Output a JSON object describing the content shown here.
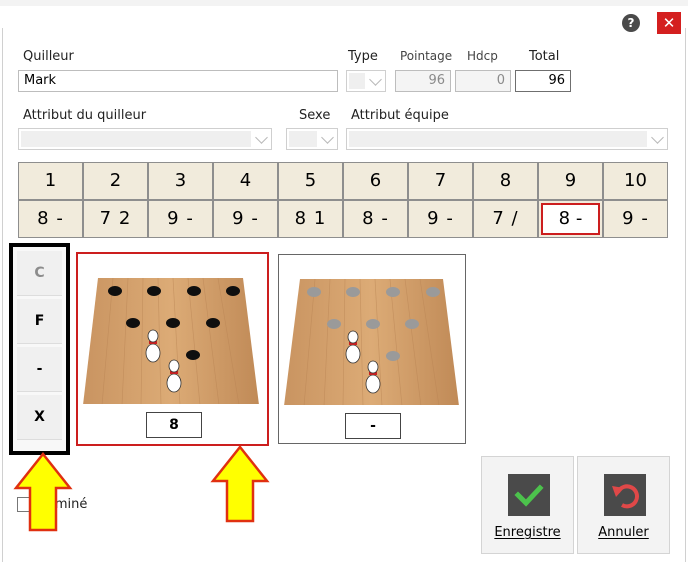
{
  "titlebar": {
    "help_icon": "?",
    "close_icon": "✕"
  },
  "bowler": {
    "label": "Quilleur",
    "value": "Mark",
    "type_label": "Type",
    "pointage_label": "Pointage",
    "pointage_value": "96",
    "hdcp_label": "Hdcp",
    "hdcp_value": "0",
    "total_label": "Total",
    "total_value": "96"
  },
  "attributes": {
    "bowler_attr_label": "Attribut du quilleur",
    "sexe_label": "Sexe",
    "team_attr_label": "Attribut équipe"
  },
  "frames": [
    {
      "num": "1",
      "score": "8 -"
    },
    {
      "num": "2",
      "score": "7 2"
    },
    {
      "num": "3",
      "score": "9 -"
    },
    {
      "num": "4",
      "score": "9 -"
    },
    {
      "num": "5",
      "score": "8 1"
    },
    {
      "num": "6",
      "score": "8 -"
    },
    {
      "num": "7",
      "score": "9 -"
    },
    {
      "num": "8",
      "score": "7 /"
    },
    {
      "num": "9",
      "score": "8 -"
    },
    {
      "num": "10",
      "score": "9 -"
    }
  ],
  "selected_frame": 9,
  "quick_buttons": [
    "C",
    "F",
    "-",
    "X"
  ],
  "rolls": [
    {
      "value": "8"
    },
    {
      "value": "-"
    }
  ],
  "finished_label": "Terminé",
  "actions": {
    "save_label": "Enregistre",
    "cancel_label": "Annuler"
  },
  "colors": {
    "close_red": "#d41f1f",
    "selection_red": "#cc1e1e",
    "frame_bg": "#f1ebdc",
    "arrow_yellow": "#ffff00",
    "check_green": "#4cc24c",
    "undo_red": "#e04848"
  }
}
